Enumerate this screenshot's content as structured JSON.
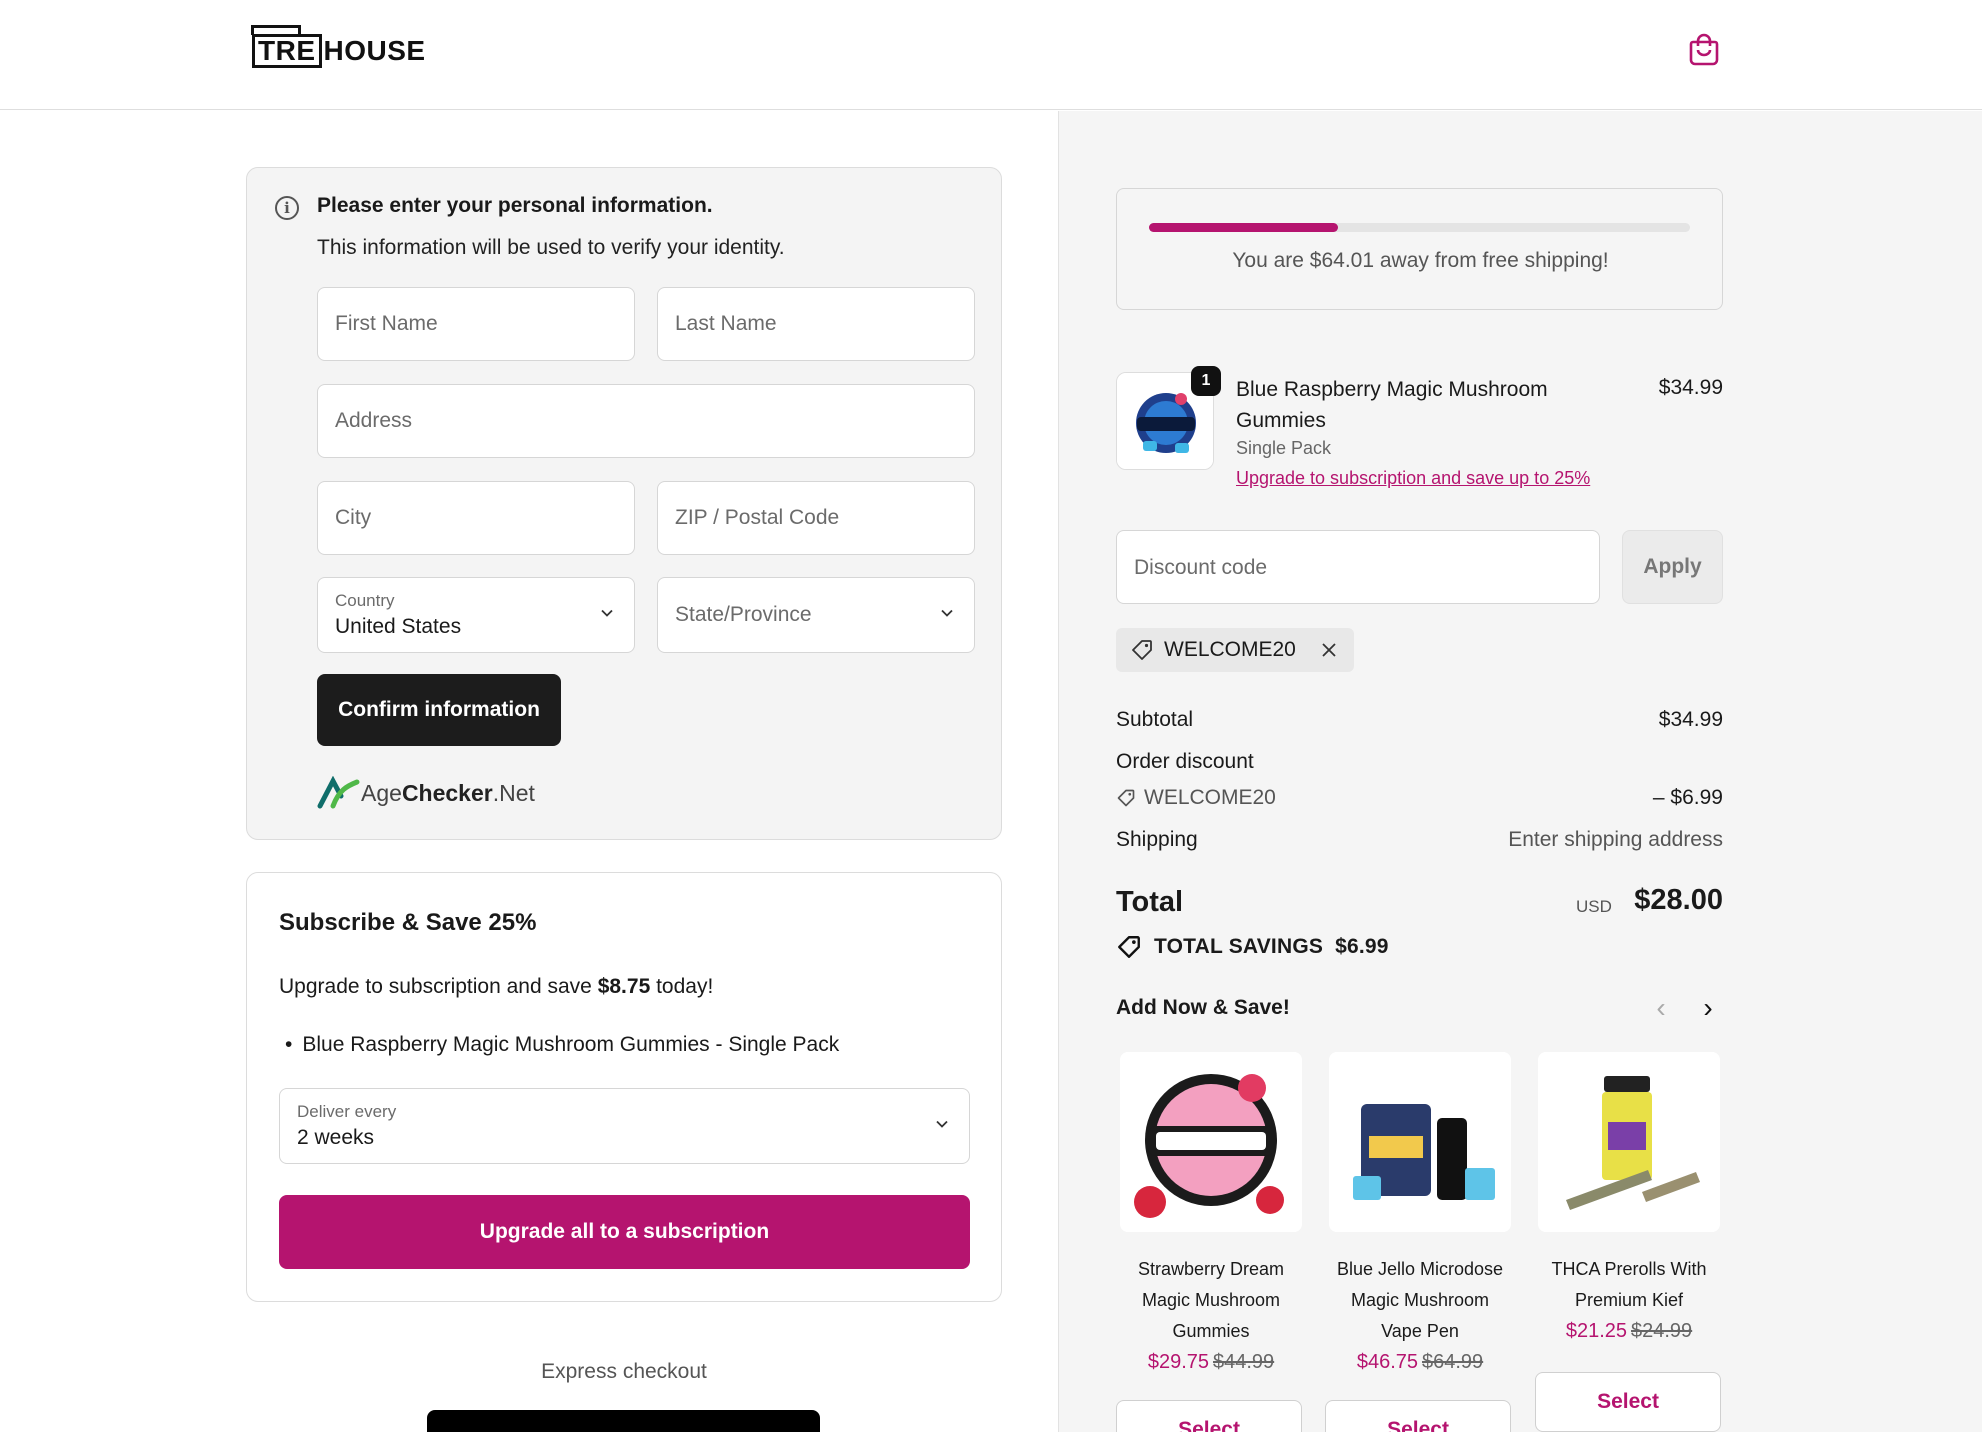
{
  "header": {
    "logo_box": "TRE",
    "logo_rest": "HOUSE",
    "cart_icon": "shopping-bag-icon"
  },
  "age_check": {
    "title": "Please enter your personal information.",
    "subtitle": "This information will be used to verify your identity.",
    "first_name_placeholder": "First Name",
    "last_name_placeholder": "Last Name",
    "address_placeholder": "Address",
    "city_placeholder": "City",
    "zip_placeholder": "ZIP / Postal Code",
    "country_label": "Country",
    "country_value": "United States",
    "state_placeholder": "State/Province",
    "confirm_label": "Confirm information",
    "provider_a": "Age",
    "provider_b": "Checker",
    "provider_c": ".Net"
  },
  "subscribe": {
    "title": "Subscribe & Save 25%",
    "text_prefix": "Upgrade to subscription and save ",
    "save_amount": "$8.75",
    "text_suffix": " today!",
    "item": "Blue Raspberry Magic Mushroom Gummies - Single Pack",
    "deliver_label": "Deliver every",
    "deliver_value": "2 weeks",
    "upgrade_label": "Upgrade all to a subscription"
  },
  "express": {
    "label": "Express checkout"
  },
  "shipping_progress": {
    "text": "You are $64.01 away from free shipping!",
    "fraction": 0.35
  },
  "cart": {
    "items": [
      {
        "name": "Blue Raspberry Magic Mushroom Gummies",
        "variant": "Single Pack",
        "upgrade_link": "Upgrade to subscription and save up to 25%",
        "price": "$34.99",
        "quantity": "1"
      }
    ]
  },
  "discount": {
    "placeholder": "Discount code",
    "apply_label": "Apply",
    "applied_code": "WELCOME20"
  },
  "summary": {
    "subtotal_label": "Subtotal",
    "subtotal_value": "$34.99",
    "discount_label": "Order discount",
    "discount_code": "WELCOME20",
    "discount_value": "– $6.99",
    "shipping_label": "Shipping",
    "shipping_value": "Enter shipping address",
    "total_label": "Total",
    "currency": "USD",
    "total_value": "$28.00",
    "savings_label": "TOTAL SAVINGS",
    "savings_value": "$6.99"
  },
  "upsell": {
    "title": "Add Now & Save!",
    "products": [
      {
        "name": "Strawberry Dream Magic Mushroom Gummies",
        "sale": "$29.75",
        "old": "$44.99",
        "select": "Select"
      },
      {
        "name": "Blue Jello Microdose Magic Mushroom Vape Pen",
        "sale": "$46.75",
        "old": "$64.99",
        "select": "Select"
      },
      {
        "name": "THCA Prerolls With Premium Kief",
        "sale": "$21.25",
        "old": "$24.99",
        "select": "Select"
      }
    ]
  },
  "colors": {
    "accent": "#b5146f",
    "dark_button": "#1c1c1c"
  }
}
